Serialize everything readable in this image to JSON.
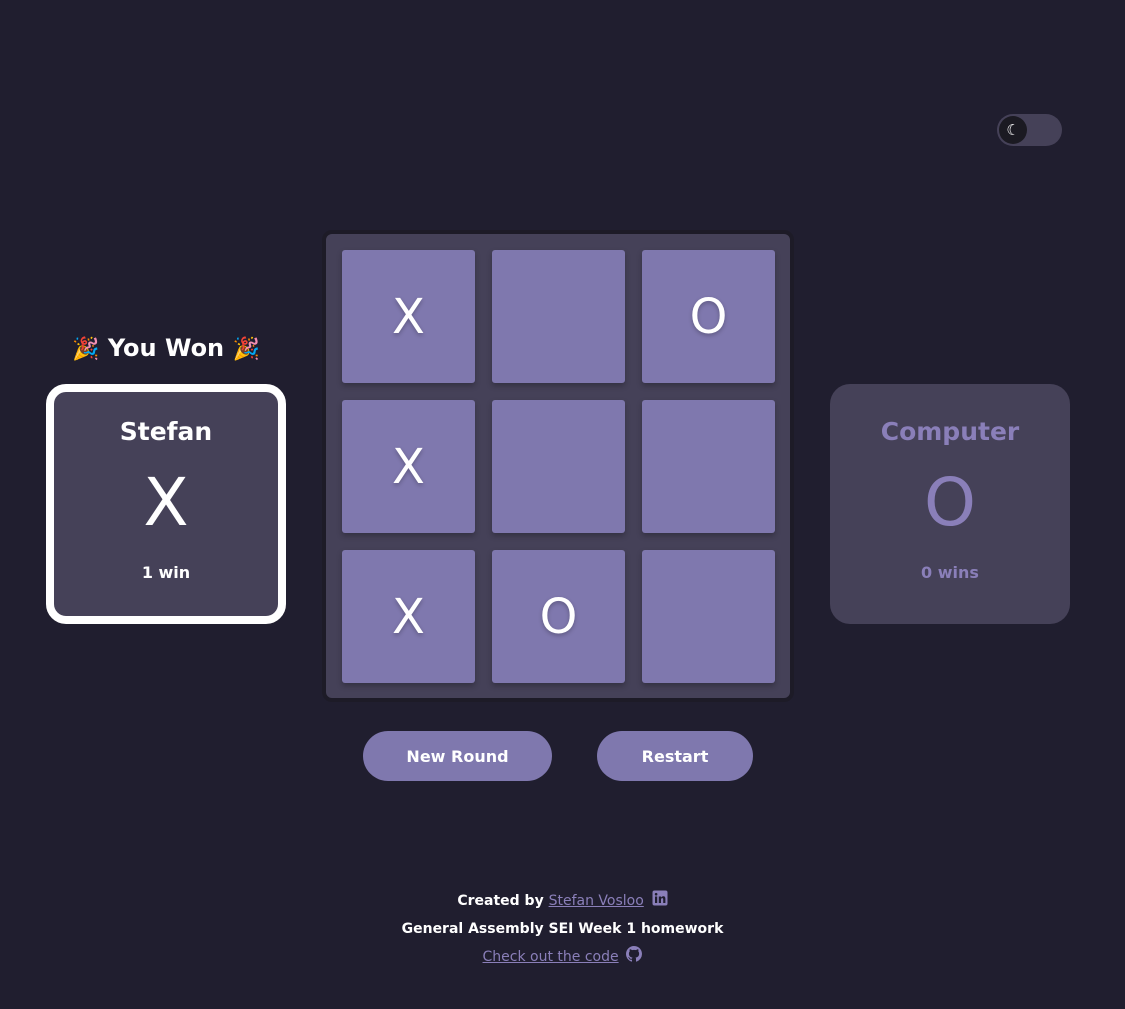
{
  "theme_toggle": {
    "icon": "☾",
    "icon_name": "moon-icon"
  },
  "banner": {
    "party_left": "🎉",
    "text": "You Won",
    "party_right": "🎉"
  },
  "players": [
    {
      "name": "Stefan",
      "symbol": "X",
      "wins": "1 win",
      "winner": true
    },
    {
      "name": "Computer",
      "symbol": "O",
      "wins": "0 wins",
      "winner": false
    }
  ],
  "board": {
    "cells": [
      "X",
      "",
      "O",
      "X",
      "",
      "",
      "X",
      "O",
      ""
    ]
  },
  "buttons": {
    "new_round": "New Round",
    "restart": "Restart"
  },
  "footer": {
    "created_by": "Created by",
    "author_link": "Stefan Vosloo",
    "course": "General Assembly SEI Week 1 homework",
    "code_link": "Check out the code"
  },
  "colors": {
    "background": "#201e2f",
    "card": "#454158",
    "cell": "#7f78ae",
    "accent": "#8a7fb9"
  }
}
